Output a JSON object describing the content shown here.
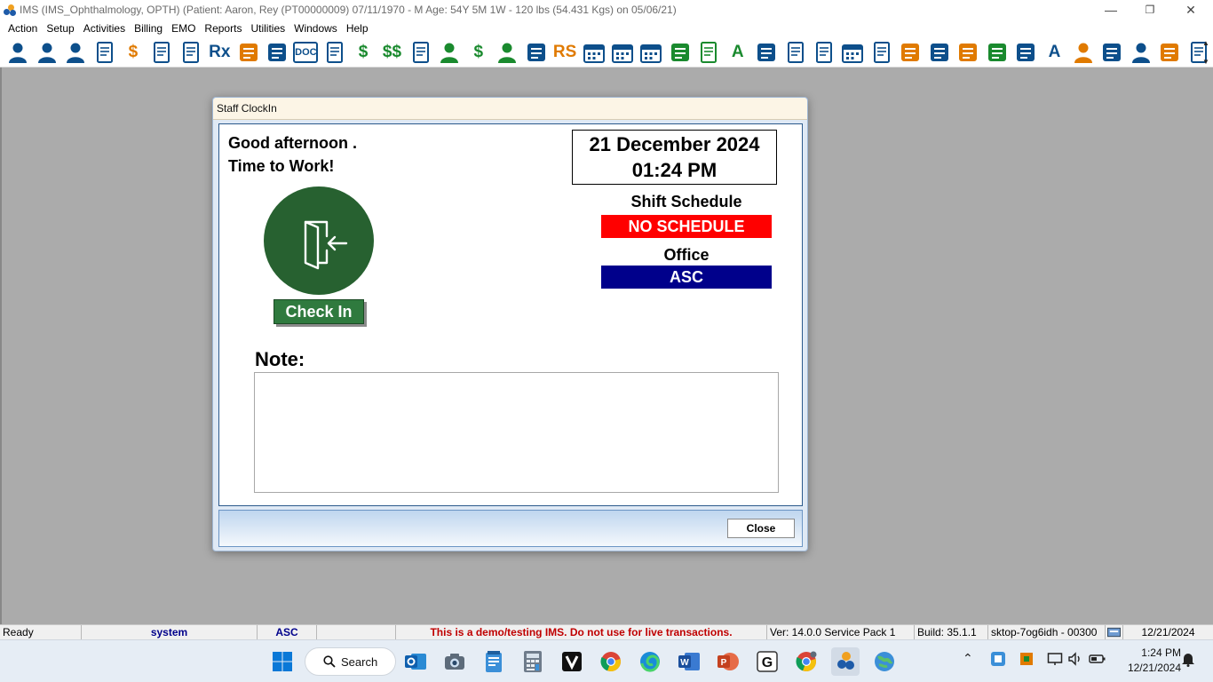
{
  "window": {
    "title": "IMS (IMS_Ophthalmology, OPTH)     (Patient: Aaron, Rey  (PT00000009) 07/11/1970 - M Age: 54Y 5M 1W - 120 lbs (54.431 Kgs) on 05/06/21)",
    "minimize": "—",
    "restore": "❐",
    "close": "✕"
  },
  "menu": [
    "Action",
    "Setup",
    "Activities",
    "Billing",
    "EMO",
    "Reports",
    "Utilities",
    "Windows",
    "Help"
  ],
  "toolbar_icons": [
    {
      "name": "patient-icon",
      "glyph": "",
      "color": "#0d4f8b"
    },
    {
      "name": "patient-check-icon",
      "glyph": "",
      "color": "#0d4f8b"
    },
    {
      "name": "patient-verified-icon",
      "glyph": "",
      "color": "#0d4f8b"
    },
    {
      "name": "edit-document-icon",
      "glyph": "",
      "color": "#0d4f8b"
    },
    {
      "name": "superbill-icon",
      "glyph": "$",
      "color": "#e07a00"
    },
    {
      "name": "demographics-icon",
      "glyph": "",
      "color": "#0d4f8b"
    },
    {
      "name": "prescription-search-icon",
      "glyph": "",
      "color": "#0d4f8b"
    },
    {
      "name": "rx-icon",
      "glyph": "Rx",
      "color": "#0d4f8b"
    },
    {
      "name": "lab-flask-icon",
      "glyph": "",
      "color": "#e07a00"
    },
    {
      "name": "eprescribe-icon",
      "glyph": "",
      "color": "#0d4f8b"
    },
    {
      "name": "doc-icon",
      "glyph": "DOC",
      "color": "#0d4f8b"
    },
    {
      "name": "notepad-icon",
      "glyph": "",
      "color": "#0d4f8b"
    },
    {
      "name": "dollar-icon",
      "glyph": "$",
      "color": "#1a8a2e"
    },
    {
      "name": "double-dollar-icon",
      "glyph": "$$",
      "color": "#1a8a2e"
    },
    {
      "name": "billing-statement-icon",
      "glyph": "",
      "color": "#0d4f8b"
    },
    {
      "name": "payment-user-icon",
      "glyph": "",
      "color": "#1a8a2e"
    },
    {
      "name": "payment-icon",
      "glyph": "$",
      "color": "#1a8a2e"
    },
    {
      "name": "patient-payment-icon",
      "glyph": "",
      "color": "#1a8a2e"
    },
    {
      "name": "phone-recall-icon",
      "glyph": "",
      "color": "#0d4f8b"
    },
    {
      "name": "rs-icon",
      "glyph": "RS",
      "color": "#e07a00"
    },
    {
      "name": "calendar-icon",
      "glyph": "",
      "color": "#0d4f8b"
    },
    {
      "name": "calendar-grid-icon",
      "glyph": "",
      "color": "#0d4f8b"
    },
    {
      "name": "calendar-edit-icon",
      "glyph": "",
      "color": "#0d4f8b"
    },
    {
      "name": "exit-door-icon",
      "glyph": "",
      "color": "#1a8a2e"
    },
    {
      "name": "task-check-icon",
      "glyph": "",
      "color": "#1a8a2e"
    },
    {
      "name": "letter-a-icon",
      "glyph": "A",
      "color": "#1a8a2e"
    },
    {
      "name": "arrow-tag-icon",
      "glyph": "",
      "color": "#0d4f8b"
    },
    {
      "name": "fax-upload-icon",
      "glyph": "",
      "color": "#0d4f8b"
    },
    {
      "name": "fax-icon",
      "glyph": "",
      "color": "#0d4f8b"
    },
    {
      "name": "schedule-clock-icon",
      "glyph": "",
      "color": "#0d4f8b"
    },
    {
      "name": "checklist-icon",
      "glyph": "",
      "color": "#0d4f8b"
    },
    {
      "name": "pie-chart-icon",
      "glyph": "",
      "color": "#e07a00"
    },
    {
      "name": "contact-card-icon",
      "glyph": "",
      "color": "#0d4f8b"
    },
    {
      "name": "folder-icon",
      "glyph": "",
      "color": "#e07a00"
    },
    {
      "name": "binder-icon",
      "glyph": "",
      "color": "#1a8a2e"
    },
    {
      "name": "phone-book-icon",
      "glyph": "",
      "color": "#0d4f8b"
    },
    {
      "name": "translate-icon",
      "glyph": "A",
      "color": "#0d4f8b"
    },
    {
      "name": "team-icon",
      "glyph": "",
      "color": "#e07a00"
    },
    {
      "name": "growth-chart-icon",
      "glyph": "",
      "color": "#0d4f8b"
    },
    {
      "name": "support-icon",
      "glyph": "",
      "color": "#0d4f8b"
    },
    {
      "name": "alarm-clock-icon",
      "glyph": "",
      "color": "#e07a00"
    },
    {
      "name": "clipboard-icon",
      "glyph": "",
      "color": "#0d4f8b"
    }
  ],
  "toolbar_scroll": {
    "up": "▲",
    "down": "▼"
  },
  "dialog": {
    "title": "Staff ClockIn",
    "greeting_line1": "Good afternoon .",
    "greeting_line2": "Time to Work!",
    "date": "21 December 2024",
    "time": "01:24 PM",
    "shift_label": "Shift Schedule",
    "shift_value": "NO SCHEDULE",
    "shift_color": "#ff0000",
    "office_label": "Office",
    "office_value": "ASC",
    "office_color": "#00008b",
    "checkin_label": "Check In",
    "note_label": "Note:",
    "note_value": "",
    "close_label": "Close"
  },
  "statusbar": {
    "state": "Ready",
    "user": "system",
    "office": "ASC",
    "blank": "",
    "warning": "This is a demo/testing IMS. Do not use for live transactions.",
    "version": "Ver: 14.0.0 Service Pack 1",
    "build": "Build: 35.1.1",
    "machine": "sktop-7og6idh - 00300",
    "date": "12/21/2024"
  },
  "taskbar": {
    "search_label": "Search",
    "clock_time": "1:24 PM",
    "clock_date": "12/21/2024",
    "tray_up": "⌃"
  }
}
